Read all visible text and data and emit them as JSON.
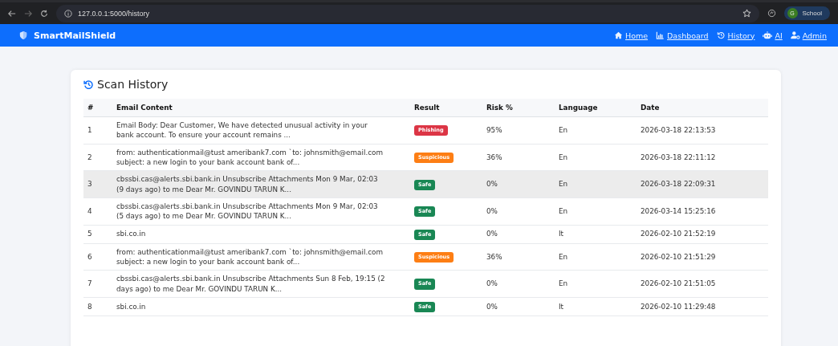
{
  "browser": {
    "url": "127.0.0.1:5000/history",
    "profile_initial": "G",
    "profile_name": "School"
  },
  "navbar": {
    "brand": "SmartMailShield",
    "links": [
      {
        "label": "Home",
        "kind": "home"
      },
      {
        "label": "Dashboard",
        "kind": "chart"
      },
      {
        "label": "History",
        "kind": "history"
      },
      {
        "label": "AI",
        "kind": "robot"
      },
      {
        "label": "Admin",
        "kind": "user"
      }
    ]
  },
  "card": {
    "title": "Scan History"
  },
  "table": {
    "columns": [
      "#",
      "Email Content",
      "Result",
      "Risk %",
      "Language",
      "Date"
    ],
    "rows": [
      {
        "num": "1",
        "content": "Email Body: Dear Customer, We have detected unusual activity in your bank account. To ensure your account remains ...",
        "result": "Phishing",
        "kind": "phishing",
        "risk": "95%",
        "language": "En",
        "date": "2026-03-18 22:13:53",
        "selected": false
      },
      {
        "num": "2",
        "content": "from: authenticationmail@tust ameribank7.com `to: johnsmith@email.com subject: a new login to your bank account bank of...",
        "result": "Suspicious",
        "kind": "suspicious",
        "risk": "36%",
        "language": "En",
        "date": "2026-03-18 22:11:12",
        "selected": false
      },
      {
        "num": "3",
        "content": "cbssbi.cas@alerts.sbi.bank.in Unsubscribe Attachments Mon 9 Mar, 02:03 (9 days ago) to me Dear Mr. GOVINDU TARUN K...",
        "result": "Safe",
        "kind": "safe",
        "risk": "0%",
        "language": "En",
        "date": "2026-03-18 22:09:31",
        "selected": true
      },
      {
        "num": "4",
        "content": "cbssbi.cas@alerts.sbi.bank.in Unsubscribe Attachments Mon 9 Mar, 02:03 (5 days ago) to me Dear Mr. GOVINDU TARUN K...",
        "result": "Safe",
        "kind": "safe",
        "risk": "0%",
        "language": "En",
        "date": "2026-03-14 15:25:16",
        "selected": false
      },
      {
        "num": "5",
        "content": "sbi.co.in",
        "result": "Safe",
        "kind": "safe",
        "risk": "0%",
        "language": "It",
        "date": "2026-02-10 21:52:19",
        "selected": false
      },
      {
        "num": "6",
        "content": "from: authenticationmail@tust ameribank7.com `to: johnsmith@email.com subject: a new login to your bank account bank of...",
        "result": "Suspicious",
        "kind": "suspicious",
        "risk": "36%",
        "language": "En",
        "date": "2026-02-10 21:51:29",
        "selected": false
      },
      {
        "num": "7",
        "content": "cbssbi.cas@alerts.sbi.bank.in Unsubscribe Attachments Sun 8 Feb, 19:15 (2 days ago) to me Dear Mr. GOVINDU TARUN K...",
        "result": "Safe",
        "kind": "safe",
        "risk": "0%",
        "language": "En",
        "date": "2026-02-10 21:51:05",
        "selected": false
      },
      {
        "num": "8",
        "content": "sbi.co.in",
        "result": "Safe",
        "kind": "safe",
        "risk": "0%",
        "language": "It",
        "date": "2026-02-10 11:29:48",
        "selected": false
      }
    ]
  }
}
